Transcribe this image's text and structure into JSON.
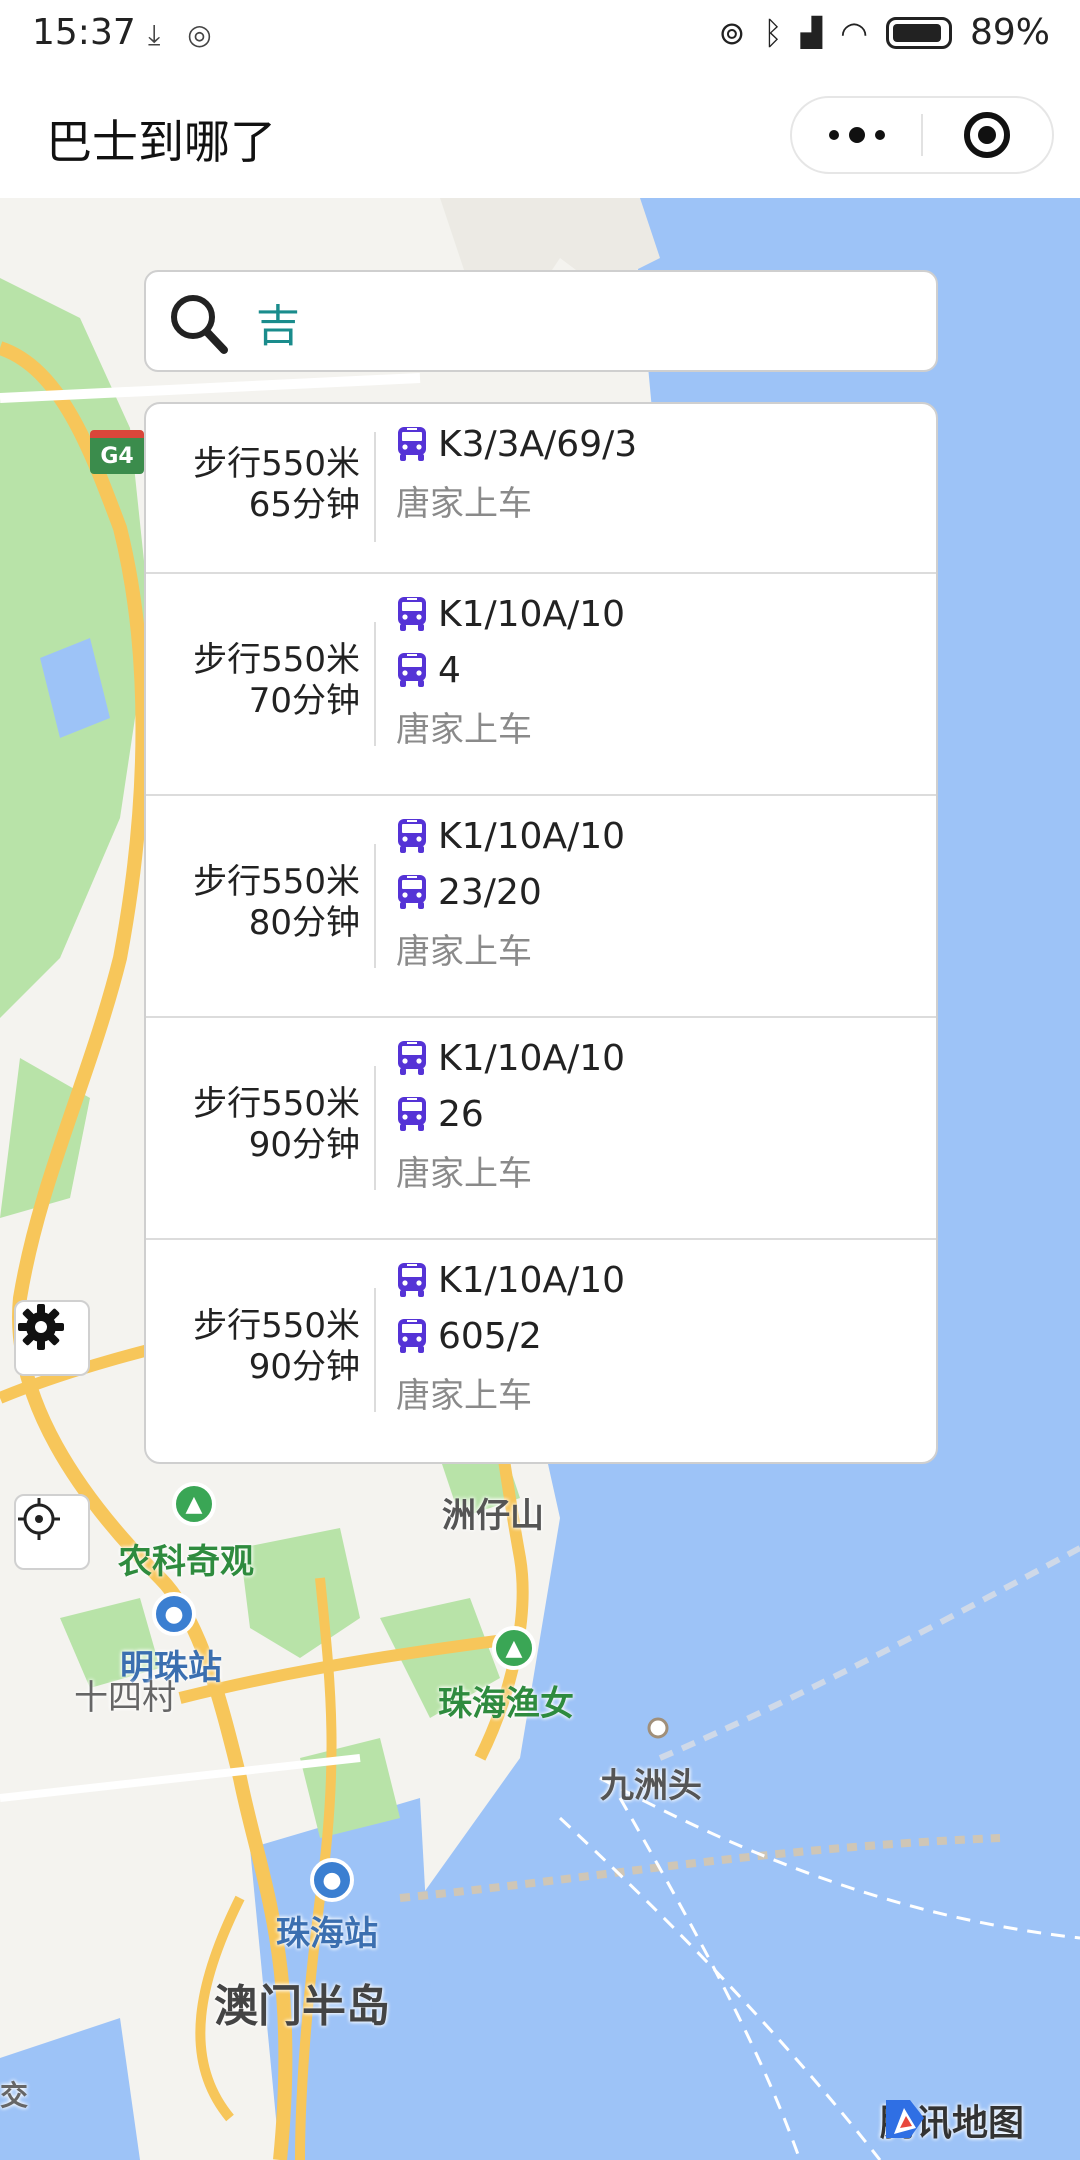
{
  "status_bar": {
    "time": "15:37",
    "battery_percent_text": "89%",
    "battery_level": 0.89,
    "icons": [
      "download-icon",
      "hotspot-icon",
      "hotspot-icon",
      "bluetooth-icon",
      "signal-hd-icon",
      "wifi-icon",
      "battery-icon"
    ]
  },
  "header": {
    "title": "巴士到哪了",
    "more_icon": "more-dots-icon",
    "close_icon": "target-circle-icon"
  },
  "search": {
    "icon": "search-icon",
    "value": "吉",
    "placeholder": ""
  },
  "results": [
    {
      "walk": "步行550米",
      "duration": "65分钟",
      "lines": [
        "K3/3A/69/3"
      ],
      "board": "唐家上车"
    },
    {
      "walk": "步行550米",
      "duration": "70分钟",
      "lines": [
        "K1/10A/10",
        "4"
      ],
      "board": "唐家上车"
    },
    {
      "walk": "步行550米",
      "duration": "80分钟",
      "lines": [
        "K1/10A/10",
        "23/20"
      ],
      "board": "唐家上车"
    },
    {
      "walk": "步行550米",
      "duration": "90分钟",
      "lines": [
        "K1/10A/10",
        "26"
      ],
      "board": "唐家上车"
    },
    {
      "walk": "步行550米",
      "duration": "90分钟",
      "lines": [
        "K1/10A/10",
        "605/2"
      ],
      "board": "唐家上车"
    }
  ],
  "map": {
    "labels": {
      "zhouzaishan": "洲仔山",
      "nongke": "农科奇观",
      "mingzhu": "明珠站",
      "shisi": "十四村",
      "yunu": "珠海渔女",
      "jiuzhou": "九洲头",
      "zhuhai_station": "珠海站",
      "aomen": "澳门半岛",
      "jiao": "交",
      "highway": "G4"
    },
    "colors": {
      "sea": "#9dc3f7",
      "land": "#f4f3ef",
      "green": "#b8e3a8",
      "road": "#f7c65a"
    }
  },
  "controls": {
    "settings_icon": "gear-icon",
    "locate_icon": "locate-icon"
  },
  "brand": {
    "text": "腾讯地图",
    "icon": "tencent-map-logo-icon"
  },
  "accent": {
    "bus_icon_color": "#5533d6",
    "search_text_color": "#1a8c8c"
  }
}
